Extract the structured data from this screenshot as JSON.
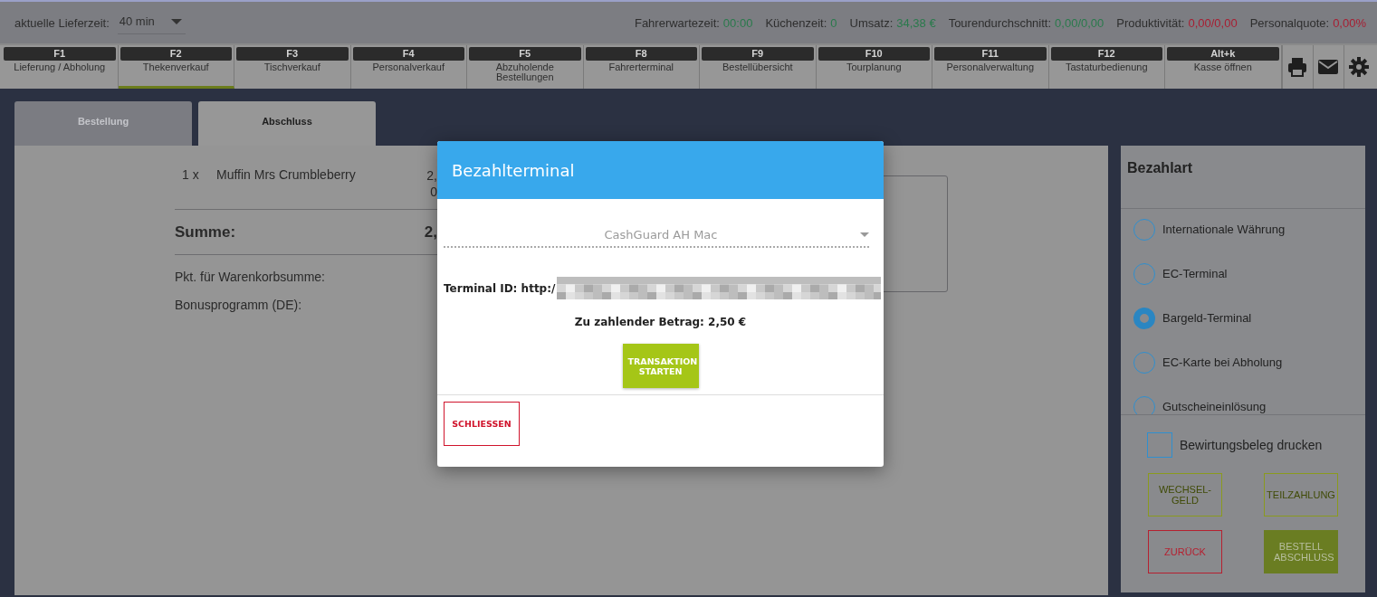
{
  "header": {
    "delivery_time": {
      "label": "aktuelle Lieferzeit:",
      "value": "40 min"
    },
    "stats": [
      {
        "label": "Fahrerwartezeit:",
        "value": "00:00",
        "color": "#2a7a4c"
      },
      {
        "label": "Küchenzeit:",
        "value": "0",
        "color": "#2a7a4c"
      },
      {
        "label": "Umsatz:",
        "value": "34,38 €",
        "color": "#2a7a4c"
      },
      {
        "label": "Tourendurchschnitt:",
        "value": "0,00/0,00",
        "color": "#2a7a4c"
      },
      {
        "label": "Produktivität:",
        "value": "0,00/0,00",
        "color": "#a81e32"
      },
      {
        "label": "Personalquote:",
        "value": "0,00%",
        "color": "#a81e32"
      }
    ]
  },
  "function_keys": [
    {
      "key": "F1",
      "label": "Lieferung / Abholung",
      "selected": false
    },
    {
      "key": "F2",
      "label": "Thekenverkauf",
      "selected": true
    },
    {
      "key": "F3",
      "label": "Tischverkauf",
      "selected": false
    },
    {
      "key": "F4",
      "label": "Personalverkauf",
      "selected": false
    },
    {
      "key": "F5",
      "label": "Abzuholende Bestellungen",
      "selected": false
    },
    {
      "key": "F8",
      "label": "Fahrerterminal",
      "selected": false
    },
    {
      "key": "F9",
      "label": "Bestellübersicht",
      "selected": false
    },
    {
      "key": "F10",
      "label": "Tourplanung",
      "selected": false
    },
    {
      "key": "F11",
      "label": "Personalverwaltung",
      "selected": false
    },
    {
      "key": "F12",
      "label": "Tastaturbedienung",
      "selected": false
    },
    {
      "key": "Alt+k",
      "label": "Kasse öffnen",
      "selected": false
    }
  ],
  "order_tabs": [
    {
      "label": "Bestellung",
      "selected": false
    },
    {
      "label": "Abschluss",
      "selected": true
    }
  ],
  "order": {
    "items": [
      {
        "quantity": "1 x",
        "name": "Muffin Mrs Crumbleberry",
        "price": "2,",
        "tax": "0"
      }
    ],
    "total": {
      "label": "Summe:",
      "value": "2,"
    },
    "bonus": [
      {
        "label": "Pkt. für Warenkorbsumme:"
      },
      {
        "label": "Bonusprogramm (DE):"
      }
    ]
  },
  "payment": {
    "title": "Bezahlart",
    "methods": [
      {
        "label": "Internationale Währung",
        "selected": false
      },
      {
        "label": "EC-Terminal",
        "selected": false
      },
      {
        "label": "Bargeld-Terminal",
        "selected": true
      },
      {
        "label": "EC-Karte bei Abholung",
        "selected": false
      },
      {
        "label": "Gutscheineinlösung",
        "selected": false
      }
    ],
    "receipt_checkbox": {
      "label": "Bewirtungsbeleg drucken",
      "checked": false
    },
    "buttons": [
      {
        "label": "WECHSEL-GELD",
        "kind": "outline"
      },
      {
        "label": "TEILZAHLUNG",
        "kind": "outline"
      },
      {
        "label": "ZURÜCK",
        "kind": "cancel"
      },
      {
        "label": "BESTELL ABSCHLUSS",
        "kind": "primary"
      }
    ]
  },
  "dialog": {
    "title": "Bezahlterminal",
    "terminal_select": {
      "value": "CashGuard AH Mac"
    },
    "terminal_id": "Terminal ID: http:/",
    "amount": "Zu zahlender Betrag: 2,50 €",
    "start_button": "TRANSAKTION STARTEN",
    "close_button": "SCHLIESSEN"
  }
}
